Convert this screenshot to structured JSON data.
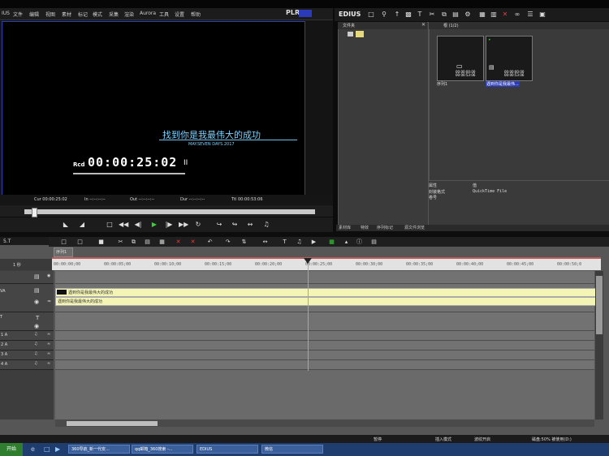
{
  "menu": {
    "items": [
      "IUS",
      "文件",
      "编辑",
      "视图",
      "素材",
      "标记",
      "模式",
      "采集",
      "渲染",
      "Aurora",
      "工具",
      "设置",
      "帮助"
    ],
    "plr_label": "PLR"
  },
  "monitor": {
    "subtitle": "找到你是我最伟大的成功",
    "subtitle_date": "MAY.SEVEN DAYS.2017",
    "rcd_label": "Rcd",
    "timecode": "00:00:25:02",
    "pause_glyph": "II",
    "cur": "Cur 00:00:25:02",
    "in": "In --:--:--:--",
    "out": "Out --:--:--:--",
    "dur": "Dur --:--:--:--",
    "ttl": "Ttl 00:00:53:06"
  },
  "bin": {
    "app_name": "EDIUS",
    "folder_title": "文件夹",
    "bin_title": "根 (1/2)",
    "clips": [
      {
        "label": "序列1",
        "tc": "00:00:00:00 00:00:53:06"
      },
      {
        "label": "遇到你是我最伟...",
        "tc": "00:00:00:00 00:00:53:06"
      }
    ],
    "props": [
      {
        "key": "属性",
        "value": "值"
      },
      {
        "key": "封装格式",
        "value": "QuickTime File"
      },
      {
        "key": "卷号",
        "value": ""
      }
    ],
    "tabs": [
      "素材库",
      "特效",
      "序列标记",
      "源文件浏览"
    ]
  },
  "timeline": {
    "title": "5.T",
    "sequence_tab": "序列1",
    "ruler": [
      "00:00:00;00",
      "00:00:05;00",
      "00:00:10;00",
      "00:00:15;00",
      "00:00:20;00",
      "00:00:25;00",
      "00:00:30;00",
      "00:00:35;00",
      "00:00:40;00",
      "00:00:45;00",
      "00:00:50;0"
    ],
    "scale_label": "1 秒",
    "tracks": [
      {
        "label": "",
        "type": "video"
      },
      {
        "label": "VA",
        "type": "va"
      },
      {
        "label": "T",
        "type": "title"
      },
      {
        "label": "1 A",
        "type": "audio"
      },
      {
        "label": "2 A",
        "type": "audio"
      },
      {
        "label": "3 A",
        "type": "audio"
      },
      {
        "label": "4 A",
        "type": "audio"
      }
    ],
    "clip_name_video": "遇到你是我最伟大的成功",
    "clip_name_audio": "遇到你是我最伟大的成功"
  },
  "status": {
    "pause": "暂停",
    "insert": "插入模式",
    "ripple": "波纹开启",
    "disk": "磁盘:50% 被使用(D:)"
  },
  "taskbar": {
    "start": "开始",
    "tasks": [
      "360导航_新一代安...",
      "qq邮箱_360搜索 -...",
      "EDIUS",
      "微信"
    ]
  },
  "colors": {
    "accent_blue": "#2a3ab8",
    "subtitle_cyan": "#7fd3ff",
    "clip_yellow": "#f4f5b5",
    "playhead": "#4ad0c0"
  }
}
